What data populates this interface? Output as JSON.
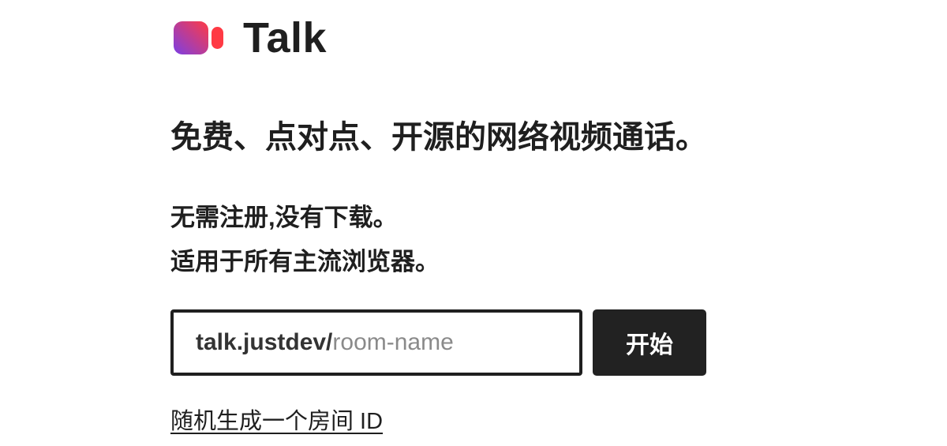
{
  "app": {
    "name": "Talk",
    "logo_icon": "video-camera-gradient-icon",
    "colors": {
      "logo_gradient_start": "#7b3fe4",
      "logo_gradient_end": "#ff3a44",
      "text": "#1f1f1f",
      "button_bg": "#222222"
    }
  },
  "hero": {
    "tagline": "免费、点对点、开源的网络视频通话。",
    "sub_line_1": "无需注册,没有下载。",
    "sub_line_2": "适用于所有主流浏览器。"
  },
  "room_form": {
    "prefix": "talk.justdev/",
    "placeholder": "room-name",
    "start_label": "开始"
  },
  "random_link": {
    "label": "随机生成一个房间 ID"
  }
}
